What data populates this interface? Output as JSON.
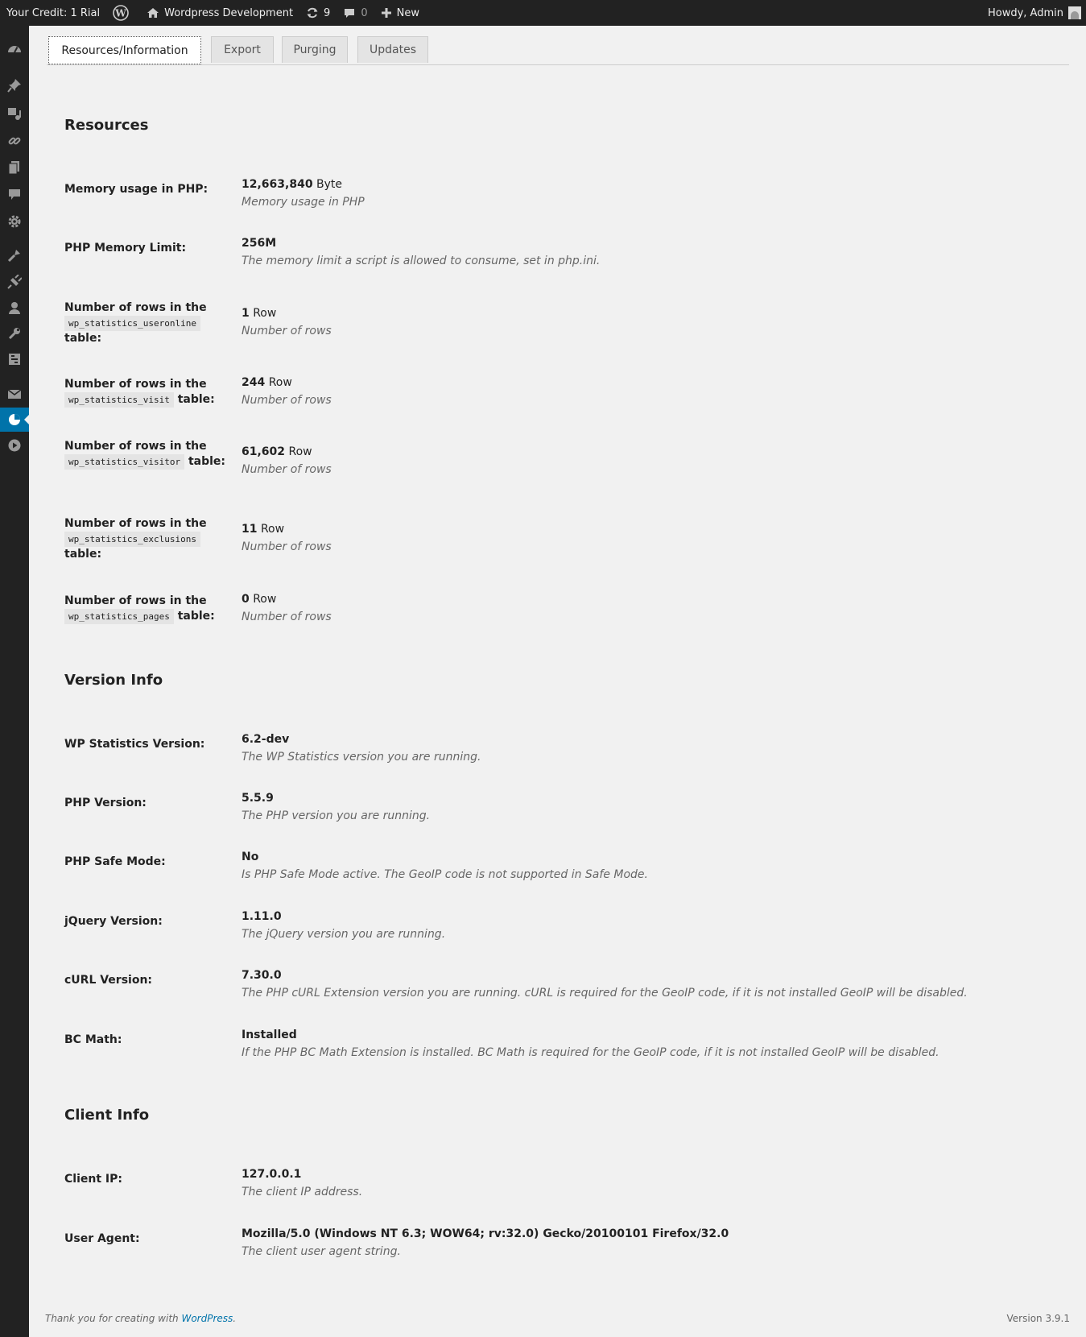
{
  "admin_bar": {
    "credit": "Your Credit: 1 Rial",
    "site_name": "Wordpress Development",
    "updates_count": "9",
    "comments_count": "0",
    "new_label": "New",
    "greeting": "Howdy, Admin"
  },
  "tabs": [
    "Resources/Information",
    "Export",
    "Purging",
    "Updates"
  ],
  "resources": {
    "heading": "Resources",
    "memory": {
      "label": "Memory usage in PHP:",
      "value": "12,663,840",
      "unit": "Byte",
      "desc": "Memory usage in PHP"
    },
    "memory_limit": {
      "label": "PHP Memory Limit:",
      "value": "256M",
      "desc": "The memory limit a script is allowed to consume, set in php.ini."
    },
    "label_prefix": "Number of rows in the",
    "label_suffix": "table:",
    "row_unit": "Row",
    "row_desc": "Number of rows",
    "tables": [
      {
        "table": "wp_statistics_useronline",
        "value": "1"
      },
      {
        "table": "wp_statistics_visit",
        "value": "244"
      },
      {
        "table": "wp_statistics_visitor",
        "value": "61,602"
      },
      {
        "table": "wp_statistics_exclusions",
        "value": "11"
      },
      {
        "table": "wp_statistics_pages",
        "value": "0"
      }
    ]
  },
  "version_info": {
    "heading": "Version Info",
    "items": [
      {
        "label": "WP Statistics Version:",
        "value": "6.2-dev",
        "desc": "The WP Statistics version you are running."
      },
      {
        "label": "PHP Version:",
        "value": "5.5.9",
        "desc": "The PHP version you are running."
      },
      {
        "label": "PHP Safe Mode:",
        "value": "No",
        "desc": "Is PHP Safe Mode active. The GeoIP code is not supported in Safe Mode."
      },
      {
        "label": "jQuery Version:",
        "value": "1.11.0",
        "desc": "The jQuery version you are running."
      },
      {
        "label": "cURL Version:",
        "value": "7.30.0",
        "desc": "The PHP cURL Extension version you are running. cURL is required for the GeoIP code, if it is not installed GeoIP will be disabled."
      },
      {
        "label": "BC Math:",
        "value": "Installed",
        "desc": "If the PHP BC Math Extension is installed. BC Math is required for the GeoIP code, if it is not installed GeoIP will be disabled."
      }
    ]
  },
  "client_info": {
    "heading": "Client Info",
    "items": [
      {
        "label": "Client IP:",
        "value": "127.0.0.1",
        "desc": "The client IP address."
      },
      {
        "label": "User Agent:",
        "value": "Mozilla/5.0 (Windows NT 6.3; WOW64; rv:32.0) Gecko/20100101 Firefox/32.0",
        "desc": "The client user agent string."
      }
    ]
  },
  "footer": {
    "thanks_prefix": "Thank you for creating with",
    "wp_link": "WordPress",
    "thanks_suffix": ".",
    "version": "Version 3.9.1"
  }
}
